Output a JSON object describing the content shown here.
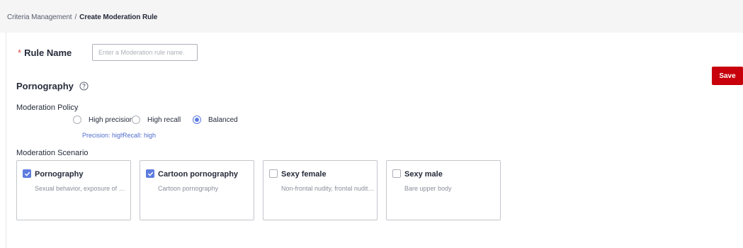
{
  "breadcrumb": {
    "parent": "Criteria Management",
    "separator": "/",
    "current": "Create Moderation Rule"
  },
  "rule_name": {
    "required_mark": "*",
    "label": "Rule Name",
    "placeholder": "Enter a Moderation rule name.",
    "value": ""
  },
  "save_label": "Save",
  "section": {
    "title": "Pornography",
    "help_icon": "question-circle-icon"
  },
  "policy": {
    "label": "Moderation Policy",
    "options": [
      {
        "label": "High precision",
        "checked": false
      },
      {
        "label": "High recall",
        "checked": false
      },
      {
        "label": "Balanced",
        "checked": true
      }
    ],
    "hints": [
      "Precision: high",
      "Recall: high"
    ]
  },
  "scenario": {
    "label": "Moderation Scenario",
    "cards": [
      {
        "title": "Pornography",
        "desc": "Sexual behavior, exposure of sexual organs",
        "checked": true
      },
      {
        "title": "Cartoon pornography",
        "desc": "Cartoon pornography",
        "checked": true
      },
      {
        "title": "Sexy female",
        "desc": "Non-frontal nudity, frontal nudity, and so on",
        "checked": false
      },
      {
        "title": "Sexy male",
        "desc": "Bare upper body",
        "checked": false
      }
    ]
  },
  "colors": {
    "primary": "#5e7ce0",
    "danger": "#c7000b",
    "hint": "#526ecc",
    "required": "#e54545"
  }
}
